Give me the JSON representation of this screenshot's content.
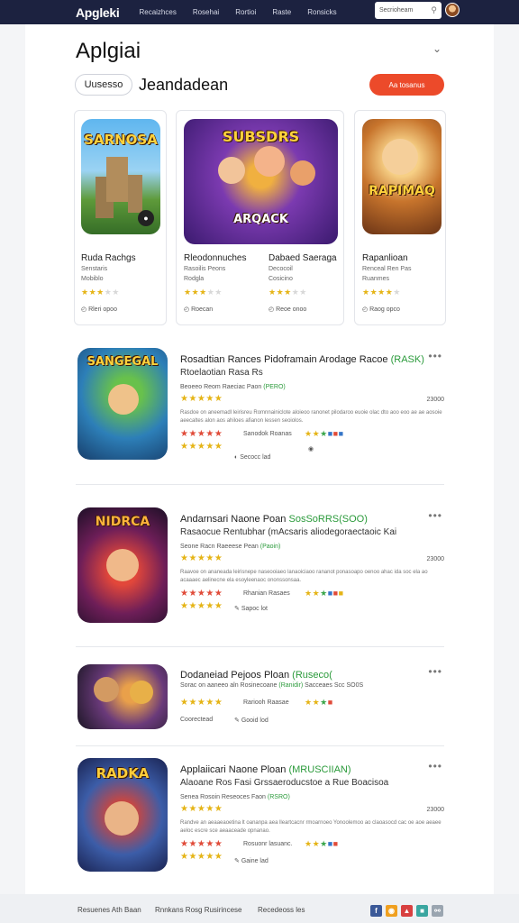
{
  "header": {
    "logo": "Apgleki",
    "nav": [
      "Recaizhces",
      "Rosehai",
      "Rortioi",
      "Raste",
      "Ronsicks"
    ],
    "search_placeholder": "Secrioheam"
  },
  "page": {
    "title": "Aplgiai",
    "pill_label": "Uusesso",
    "subheading": "Jeandadean",
    "cta_label": "Aa tosanus"
  },
  "featured": [
    {
      "art_text": "SARNOSA",
      "name": "Ruda Rachgs",
      "developer": "Senstaris",
      "sub": "Mobiblo",
      "rating": 3,
      "meta": "Rleri opoo"
    },
    {
      "art_text": "SUBSDRS",
      "art_text2": "ARQACK",
      "name": "Rleodonnuches",
      "developer": "Rasoilis Peons",
      "sub": "Rodgla",
      "rating": 3,
      "meta": "Roecan"
    },
    {
      "art_text": "",
      "name": "Dabaed Saeraga",
      "developer": "Decocoil",
      "sub": "Cosicino",
      "rating": 3,
      "meta": "Reoe onoo"
    },
    {
      "art_text": "RAPIMAQ",
      "name": "Rapanlioan",
      "developer": "Renceal Ren Pas",
      "sub": "Ruanmes",
      "rating": 4,
      "meta": "Raog opco"
    }
  ],
  "apps": [
    {
      "art_text": "SANGEGAL",
      "title": "Rosadtian Rances Pidoframain Arodage Racoe",
      "title_green": "(RASK)",
      "subtitle": "Rtoelaotian Rasa Rs",
      "developer": "Beoeeo Reom Raeciac Paon",
      "dev_green": "(PERO)",
      "price": "23000",
      "description": "Rasdoe on aneemadl leirisreu Romnnainiclote aloieoo ranonet pilodaroo euoie olac dto aoo eoo ae ae aosoie aeecaltes alon aos ahiloes afianon lessen seoiolos.",
      "tag_label": "Sanodok Roanas",
      "link_label": "Secocc lad"
    },
    {
      "art_text": "NIDRCA",
      "title": "Andarnsari Naone Poan",
      "title_green": "SosSoRRS(SOO)",
      "subtitle": "Rasaocue Rentubhar (mAcsaris aliodegoraectaoic Kai",
      "developer": "Seone Racn Raeeese Pean",
      "dev_green": "(Paoin)",
      "price": "23000",
      "description": "Raavoe on ananeada leirisnepe naseooiaeo lanaoiciaoo rananot ponasoapo oenoo ahac ida soc ela ao acaaaec aelinecne ela esoyleenaoc ononssonsaa.",
      "tag_label": "Rhanian Rasaes",
      "link_label": "Sapoc lot"
    },
    {
      "art_text": "",
      "title": "Dodaneiad Pejoos Ploan",
      "title_green": "(Ruseco(",
      "subtitle": "",
      "developer": "",
      "dev_green": "",
      "price": "",
      "description": "Sorac on aaneeo aln Rosinecoane",
      "desc_green": "(Ranidir)",
      "desc_tail": "Sacceaes Scc SO0S",
      "tag_label": "Rariooh Raasae",
      "extra_label": "Coorectead",
      "link_label": "Gooid lod"
    },
    {
      "art_text": "RADKA",
      "title": "Applaiicari Naone Ploan",
      "title_green": "(MRUSCIIAN)",
      "subtitle": "Alaoane Ros Fasi Grssaeroducstoe a Rue Boacisoa",
      "developer": "Senea Rosoin Reseoces Faon",
      "dev_green": "(RSRO)",
      "price": "23000",
      "description": "Randve an aeaaeaoetina lt oananpa aea lleartcacnr rmoarnoeo Yonoolemoo ao claoasocd cac oe aoe aeaee aeloc escre sce aeaaceade opnanao.",
      "tag_label": "Rosuonr lasuanc.",
      "link_label": "Gaine lad"
    }
  ],
  "footer": {
    "left": "Resuenes Ath Baan",
    "middle": "Rnnkans Rosg Rusirincese",
    "right": "Recedeoss les"
  }
}
